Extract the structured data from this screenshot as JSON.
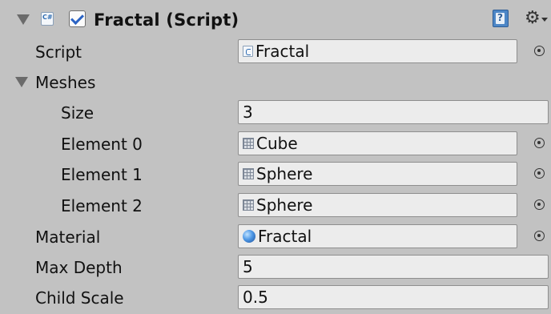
{
  "component": {
    "title": "Fractal (Script)",
    "enabled": true,
    "icons": [
      "foldout-arrow-icon",
      "script-icon",
      "help-icon",
      "gear-icon"
    ]
  },
  "fields": {
    "script": {
      "label": "Script",
      "value": "Fractal",
      "icon": "script-icon"
    },
    "meshes": {
      "label": "Meshes",
      "size_label": "Size",
      "size_value": "3",
      "elements": [
        {
          "label": "Element 0",
          "value": "Cube",
          "icon": "mesh-icon"
        },
        {
          "label": "Element 1",
          "value": "Sphere",
          "icon": "mesh-icon"
        },
        {
          "label": "Element 2",
          "value": "Sphere",
          "icon": "mesh-icon"
        }
      ]
    },
    "material": {
      "label": "Material",
      "value": "Fractal",
      "icon": "material-icon"
    },
    "max_depth": {
      "label": "Max Depth",
      "value": "5"
    },
    "child_scale": {
      "label": "Child Scale",
      "value": "0.5"
    }
  }
}
